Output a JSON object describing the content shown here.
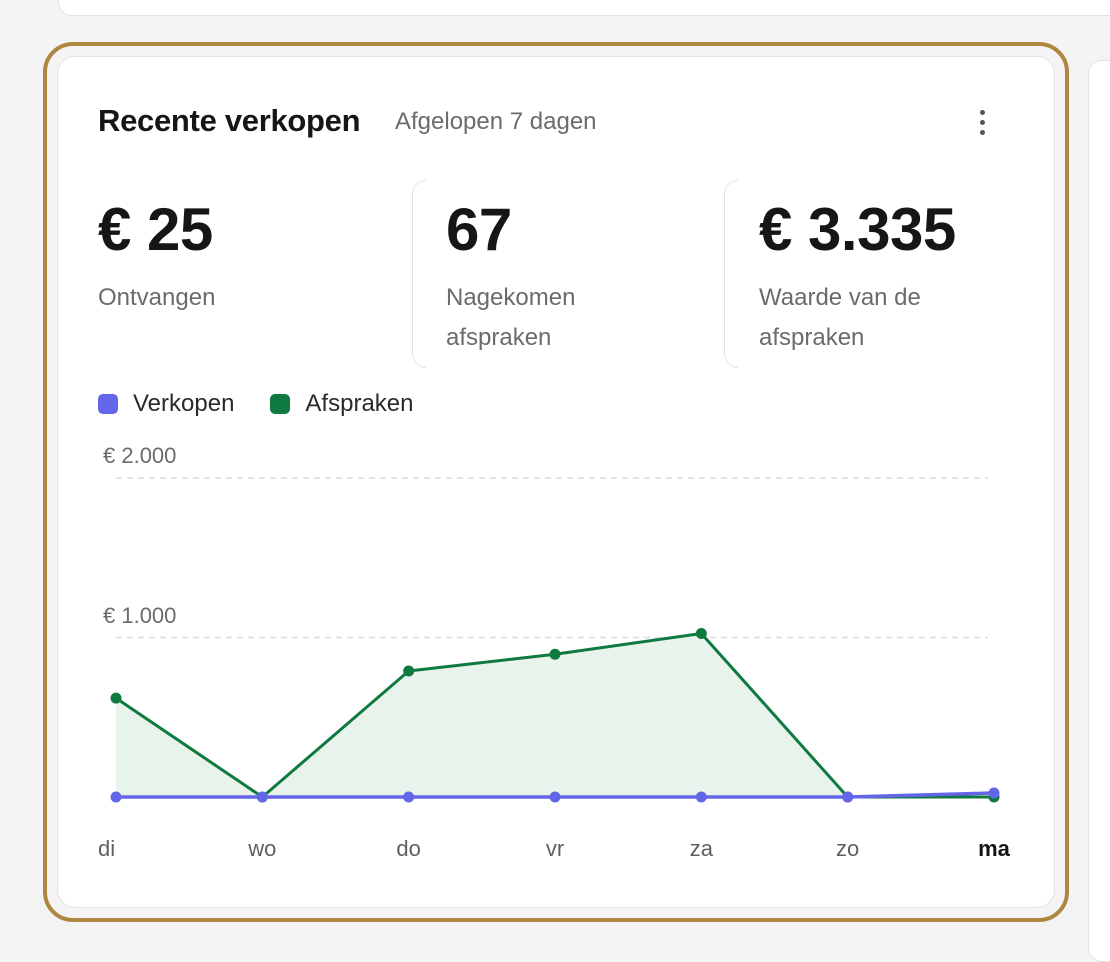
{
  "card": {
    "title": "Recente verkopen",
    "subtitle": "Afgelopen 7 dagen",
    "more_icon": "more-vertical-icon"
  },
  "stats": [
    {
      "value": "€ 25",
      "label": "Ontvangen"
    },
    {
      "value": "67",
      "label": "Nagekomen afspraken"
    },
    {
      "value": "€ 3.335",
      "label": "Waarde van de afspraken"
    }
  ],
  "colors": {
    "verkopen": "#6366e8",
    "afspraken": "#0e7a40",
    "afspraken_fill": "#e8f3ec",
    "accent_ring": "#ad873f",
    "grid": "#dcdcdc"
  },
  "chart_data": {
    "type": "line",
    "categories": [
      "di",
      "wo",
      "do",
      "vr",
      "za",
      "zo",
      "ma"
    ],
    "highlighted_category": "ma",
    "ylim": [
      0,
      2000
    ],
    "y_ticks": [
      {
        "value": 1000,
        "label": "€ 1.000"
      },
      {
        "value": 2000,
        "label": "€ 2.000"
      }
    ],
    "grid": true,
    "legend_position": "top-left",
    "series": [
      {
        "name": "Verkopen",
        "values": [
          0,
          0,
          0,
          0,
          0,
          0,
          25
        ]
      },
      {
        "name": "Afspraken",
        "values": [
          620,
          0,
          790,
          895,
          1025,
          0,
          0
        ],
        "area_fill": true
      }
    ]
  }
}
